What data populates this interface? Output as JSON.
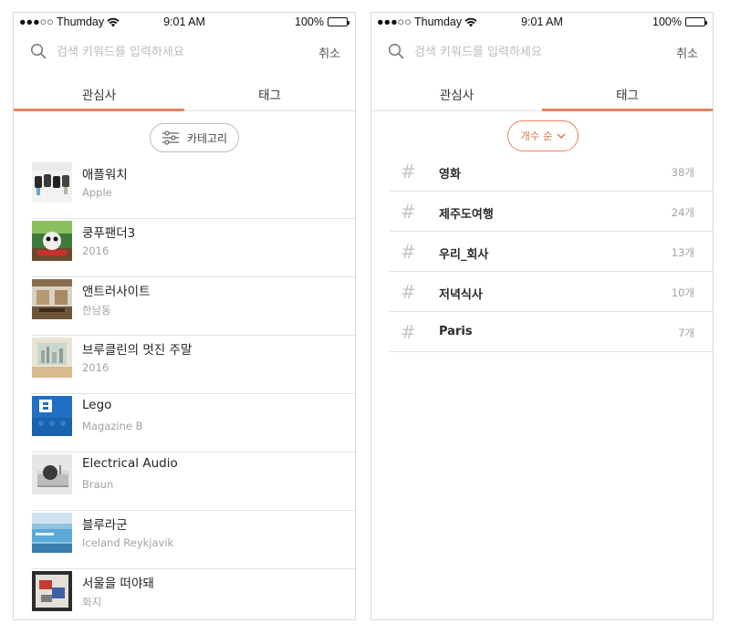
{
  "status_bar": {
    "carrier": "●●●○○ Thumday",
    "time": "9:01 AM",
    "battery": "100%"
  },
  "search": {
    "placeholder": "검색 키워드를 입력하세요",
    "cancel_label": "취소"
  },
  "tabs": [
    {
      "label": "관심사"
    },
    {
      "label": "태그"
    }
  ],
  "left_screen": {
    "active_tab": 0,
    "category_button_label": "카테고리",
    "items": [
      {
        "title": "애플워치",
        "subtitle": "Apple"
      },
      {
        "title": "쿵푸팬더3",
        "subtitle": "2016"
      },
      {
        "title": "앤트러사이트",
        "subtitle": "한남동"
      },
      {
        "title": "브루클린의 멋진 주말",
        "subtitle": "2016"
      },
      {
        "title": "Lego",
        "subtitle": "Magazine B"
      },
      {
        "title": "Electrical Audio",
        "subtitle": "Braun"
      },
      {
        "title": "블루라군",
        "subtitle": "Iceland Reykjavik"
      },
      {
        "title": "서울을 떠야돼",
        "subtitle": "화지"
      }
    ]
  },
  "right_screen": {
    "active_tab": 1,
    "sort_button_label": "개수 순",
    "tags": [
      {
        "name": "영화",
        "count": "38개"
      },
      {
        "name": "제주도여행",
        "count": "24개"
      },
      {
        "name": "우리_회사",
        "count": "13개"
      },
      {
        "name": "저녁식사",
        "count": "10개"
      },
      {
        "name": "Paris",
        "count": "7개"
      }
    ]
  },
  "colors": {
    "accent": "#e8825b",
    "divider": "#e3e3e3",
    "muted_text": "#a3a3a3"
  }
}
